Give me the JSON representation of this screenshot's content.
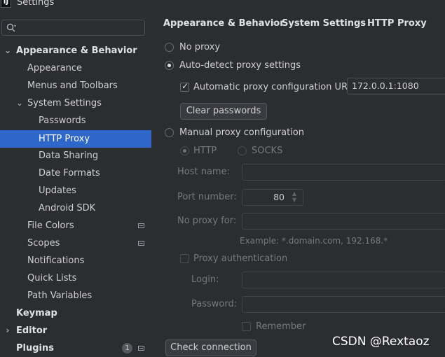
{
  "window": {
    "title": "Settings",
    "icon": "intellij-logo"
  },
  "sidebar": {
    "search": {
      "placeholder": "",
      "icon": "search-icon"
    },
    "items": [
      {
        "label": "Appearance & Behavior",
        "bold": true,
        "expanded": true
      },
      {
        "label": "Appearance"
      },
      {
        "label": "Menus and Toolbars"
      },
      {
        "label": "System Settings",
        "expanded": true
      },
      {
        "label": "Passwords"
      },
      {
        "label": "HTTP Proxy",
        "selected": true
      },
      {
        "label": "Data Sharing"
      },
      {
        "label": "Date Formats"
      },
      {
        "label": "Updates"
      },
      {
        "label": "Android SDK"
      },
      {
        "label": "File Colors",
        "icon": "project-scope-icon"
      },
      {
        "label": "Scopes",
        "icon": "project-scope-icon"
      },
      {
        "label": "Notifications"
      },
      {
        "label": "Quick Lists"
      },
      {
        "label": "Path Variables"
      },
      {
        "label": "Keymap",
        "bold": true
      },
      {
        "label": "Editor",
        "bold": true,
        "expanded": false
      },
      {
        "label": "Plugins",
        "bold": true,
        "badge": "1",
        "icon": "project-scope-icon"
      }
    ]
  },
  "breadcrumb": [
    "Appearance & Behavior",
    "System Settings",
    "HTTP Proxy"
  ],
  "breadcrumb_separator": "›",
  "proxy": {
    "no_proxy_label": "No proxy",
    "auto_detect_label": "Auto-detect proxy settings",
    "auto_config_url_label": "Automatic proxy configuration URL:",
    "auto_config_url_value": "172.0.0.1:1080",
    "auto_config_checked": true,
    "clear_passwords_label": "Clear passwords",
    "manual_label": "Manual proxy configuration",
    "selected_mode": "auto-detect",
    "http_label": "HTTP",
    "socks_label": "SOCKS",
    "host_label": "Host name:",
    "host_value": "",
    "port_label": "Port number:",
    "port_value": "80",
    "no_proxy_for_label": "No proxy for:",
    "no_proxy_for_value": "",
    "example_text": "Example: *.domain.com, 192.168.*",
    "auth_label": "Proxy authentication",
    "auth_checked": false,
    "login_label": "Login:",
    "login_value": "",
    "password_label": "Password:",
    "password_value": "",
    "remember_label": "Remember",
    "remember_checked": false,
    "check_connection_label": "Check connection"
  },
  "watermark": "CSDN @Rextaoz",
  "colors": {
    "background": "#2b2d30",
    "selection": "#2f66c9",
    "text": "#d0d0d0",
    "dim_text": "#76797e"
  }
}
